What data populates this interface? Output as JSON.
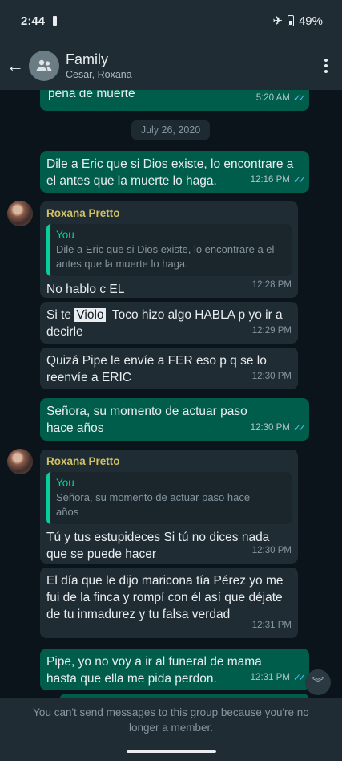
{
  "status_bar": {
    "time": "2:44",
    "battery": "49%"
  },
  "header": {
    "title": "Family",
    "subtitle": "Cesar, Roxana"
  },
  "chat": {
    "top_partial": {
      "text": "pena de muerte",
      "time": "5:20 AM"
    },
    "date_chip": "July 26, 2020",
    "msg_out_1": {
      "text": "Dile a Eric que si Dios existe, lo encontrare a el antes que la muerte lo haga.",
      "time": "12:16 PM"
    },
    "group_1": {
      "sender": "Roxana Pretto",
      "quote_name": "You",
      "quote_text": "Dile a Eric que si Dios existe, lo encontrare a el antes que la muerte lo haga.",
      "reply_text": "No hablo c EL",
      "reply_time": "12:28 PM",
      "msg2_before": "Si te ",
      "msg2_highlight": "Violo",
      "msg2_after": "  Toco hizo algo HABLA p yo ir a decirle",
      "msg2_time": "12:29 PM",
      "msg3_text": "Quizá Pipe le envíe a FER eso p q se lo reenvíe a ERIC",
      "msg3_time": "12:30 PM"
    },
    "msg_out_2": {
      "text": "Señora, su momento de actuar paso hace años",
      "time": "12:30 PM"
    },
    "group_2": {
      "sender": "Roxana Pretto",
      "quote_name": "You",
      "quote_text": "Señora, su momento de actuar paso hace años",
      "reply_text": "Tú y tus estupideces Si tú no dices nada que se puede hacer",
      "reply_time": "12:30 PM",
      "msg2_text": "El día que le dijo maricona tía Pérez yo me fui de la finca y rompí con él así que déjate de tu inmadurez y tu falsa verdad",
      "msg2_time": "12:31 PM"
    },
    "msg_out_3": {
      "text": "Pipe, yo no voy a ir al funeral de mama hasta que ella me pida perdon.",
      "time": "12:31 PM"
    }
  },
  "footer": {
    "notice": "You can't send messages to this group because you're no longer a member."
  },
  "colors": {
    "outgoing": "#005c4b",
    "incoming": "#1f2c34",
    "background": "#0b141a",
    "sender_name": "#d0c164",
    "quote_accent": "#06cf9c",
    "read_ticks": "#53bdeb"
  }
}
